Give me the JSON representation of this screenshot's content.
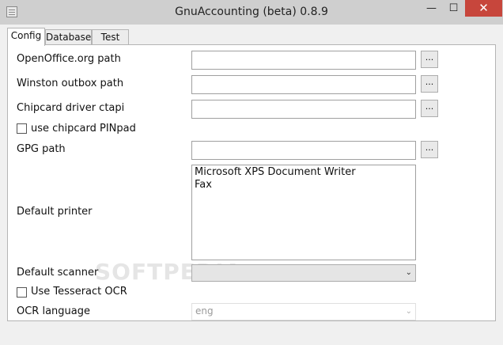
{
  "window": {
    "title": "GnuAccounting (beta) 0.8.9",
    "minimize": "—",
    "maximize": "☐",
    "close": "✕"
  },
  "tabs": [
    {
      "label": "Config",
      "active": true
    },
    {
      "label": "Database",
      "active": false
    },
    {
      "label": "Test",
      "active": false
    }
  ],
  "config": {
    "openoffice_label": "OpenOffice.org path",
    "openoffice_value": "",
    "winston_label": "Winston outbox path",
    "winston_value": "",
    "chipcard_label": "Chipcard driver ctapi",
    "chipcard_value": "",
    "pinpad_label": "use chipcard PINpad",
    "pinpad_checked": false,
    "gpg_label": "GPG path",
    "gpg_value": "",
    "browse_label": "...",
    "printer_label": "Default printer",
    "printers": [
      "Microsoft XPS Document Writer",
      "Fax"
    ],
    "scanner_label": "Default scanner",
    "scanner_value": "",
    "tesseract_label": "Use Tesseract OCR",
    "tesseract_checked": false,
    "ocr_label": "OCR language",
    "ocr_value": "eng"
  },
  "watermark": "SOFTPEDIA",
  "icons": {
    "dropdown": "chevron-down-icon"
  }
}
